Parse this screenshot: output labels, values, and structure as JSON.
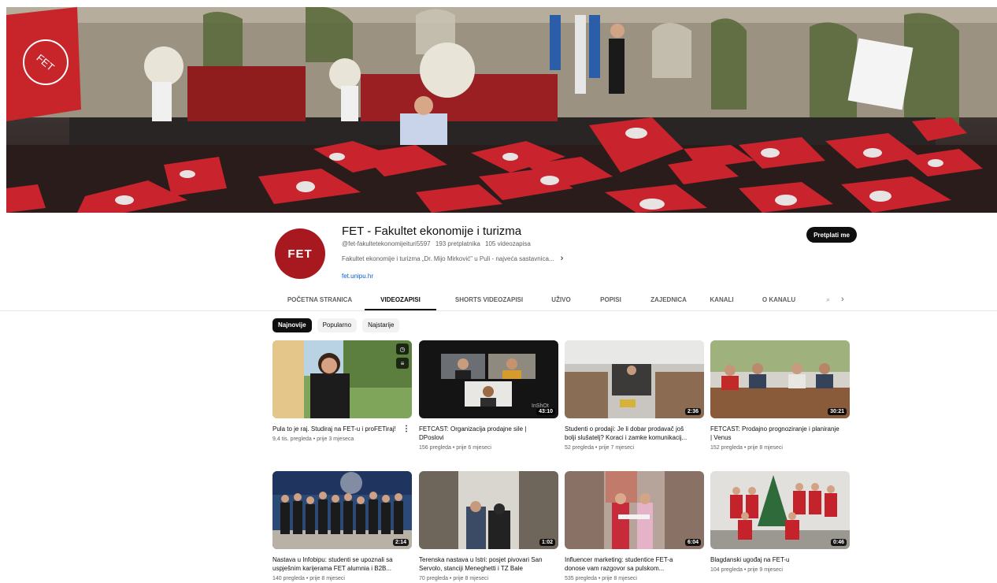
{
  "channel": {
    "name": "FET - Fakultet ekonomije i turizma",
    "avatar_text": "FET",
    "handle": "@fet-fakultetekonomijeituri5597",
    "subscribers": "193 pretplatnika",
    "video_count": "105 videozapisa",
    "description": "Fakultet ekonomije i turizma „Dr. Mijo Mirković\" u Puli - najveća sastavnica...",
    "link": "fet.unipu.hr",
    "subscribe_label": "Pretplati me",
    "banner_flag_text": "FET"
  },
  "tabs": [
    {
      "label": "POČETNA STRANICA",
      "active": false
    },
    {
      "label": "VIDEOZAPISI",
      "active": true
    },
    {
      "label": "SHORTS VIDEOZAPISI",
      "active": false
    },
    {
      "label": "UŽIVO",
      "active": false
    },
    {
      "label": "POPISI",
      "active": false
    },
    {
      "label": "ZAJEDNICA",
      "active": false
    },
    {
      "label": "KANALI",
      "active": false
    },
    {
      "label": "O KANALU",
      "active": false
    }
  ],
  "chips": [
    "Najnovije",
    "Popularno",
    "Najstarije"
  ],
  "videos": [
    {
      "title": "Pula to je raj. Studiraj na FET-u i proFETiraj!",
      "views": "9,4 tis. pregleda",
      "age": "prije 3 mjeseca",
      "duration": ""
    },
    {
      "title": "FETCAST: Organizacija prodajne sile | DPoslovi",
      "views": "156 pregleda",
      "age": "prije 6 mjeseci",
      "duration": "43:10",
      "watermark": "InShOt"
    },
    {
      "title": "Studenti o prodaji: Je li dobar prodavač još bolji slušatelj? Koraci i zamke komunikacij...",
      "views": "52 pregleda",
      "age": "prije 7 mjeseci",
      "duration": "2:36"
    },
    {
      "title": "FETCAST: Prodajno prognoziranje i planiranje | Venus",
      "views": "152 pregleda",
      "age": "prije 8 mjeseci",
      "duration": "30:21"
    },
    {
      "title": "Nastava u Infobipu: studenti se upoznali sa uspješnim karijerama FET alumnia i B2B...",
      "views": "140 pregleda",
      "age": "prije 8 mjeseci",
      "duration": "2:14"
    },
    {
      "title": "Terenska nastava u Istri: posjet pivovari San Servolo, stanciji Meneghetti i TZ Bale",
      "views": "70 pregleda",
      "age": "prije 8 mjeseci",
      "duration": "1:02"
    },
    {
      "title": "Influencer marketing: studentice FET-a donose vam razgovor sa pulskom...",
      "views": "535 pregleda",
      "age": "prije 8 mjeseci",
      "duration": "6:04"
    },
    {
      "title": "Blagdanski ugođaj na FET-u",
      "views": "104 pregleda",
      "age": "prije 9 mjeseci",
      "duration": "0:46"
    }
  ],
  "colors": {
    "brand_red": "#a8191f",
    "link_blue": "#065fd4",
    "text_primary": "#0f0f0f",
    "text_secondary": "#606060"
  }
}
